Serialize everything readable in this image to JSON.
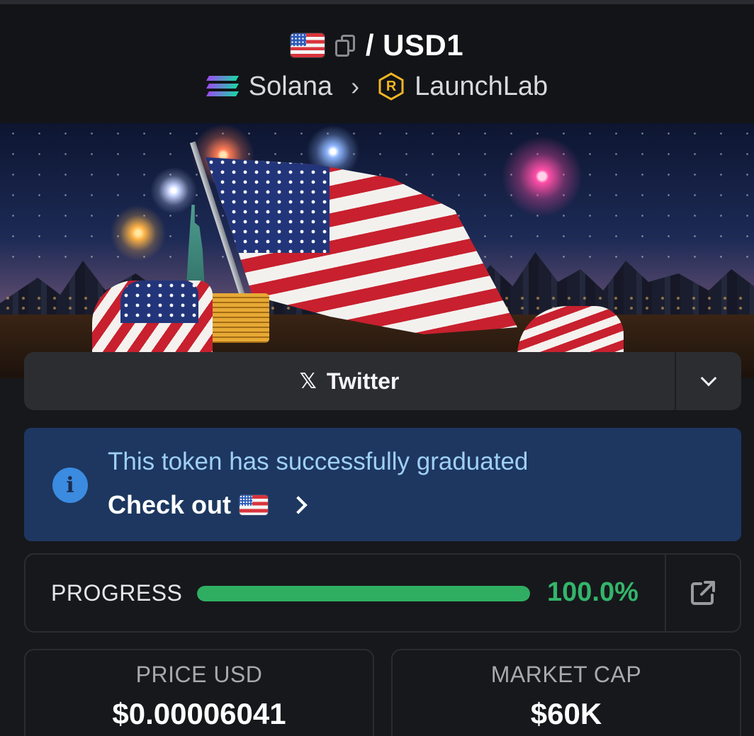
{
  "header": {
    "token_flag_icon": "us-flag-icon",
    "separator": "/",
    "symbol": "USD1",
    "chain": "Solana",
    "chain_icon": "solana-icon",
    "platform": "LaunchLab",
    "platform_icon": "launchlab-icon",
    "platform_icon_glyph": "R"
  },
  "banner": {
    "image_name": "token-banner-image"
  },
  "social": {
    "twitter_icon_glyph": "𝕏",
    "twitter_label": "Twitter",
    "dropdown_icon": "chevron-down-icon"
  },
  "notice": {
    "info_glyph": "i",
    "message": "This token has successfully graduated",
    "link_label": "Check out",
    "link_flag_icon": "us-flag-icon"
  },
  "progress": {
    "label": "PROGRESS",
    "percent_value": 100.0,
    "percent_text": "100.0%",
    "accent_color": "#2fae62"
  },
  "stats": {
    "price_label": "PRICE USD",
    "price_value": "$0.00006041",
    "mcap_label": "MARKET CAP",
    "mcap_value": "$60K"
  },
  "colors": {
    "background": "#17181c",
    "notice_bg": "#1d3760",
    "notice_text": "#9fd0f7",
    "progress_green": "#33b56a"
  }
}
